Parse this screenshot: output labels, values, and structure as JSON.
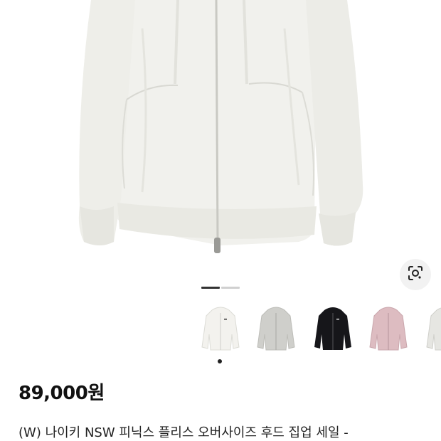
{
  "product": {
    "main_image": "white-full-zip-hoodie-photo",
    "image_count": 2,
    "current_image_index": 1,
    "price": "89,000원",
    "title": "(W) 나이키 NSW 피닉스 플리스 오버사이즈 후드 집업 세일 -"
  },
  "lens_button": {
    "icon": "camera-lens-icon"
  },
  "color_variants": [
    {
      "color": "white",
      "hex": "#f3f2ee"
    },
    {
      "color": "heather-grey",
      "hex": "#cfcfcb"
    },
    {
      "color": "black",
      "hex": "#16161a"
    },
    {
      "color": "pink",
      "hex": "#ddbcc1"
    },
    {
      "color": "light-grey",
      "hex": "#e6e6e2"
    }
  ],
  "selected_variant_index": 0
}
